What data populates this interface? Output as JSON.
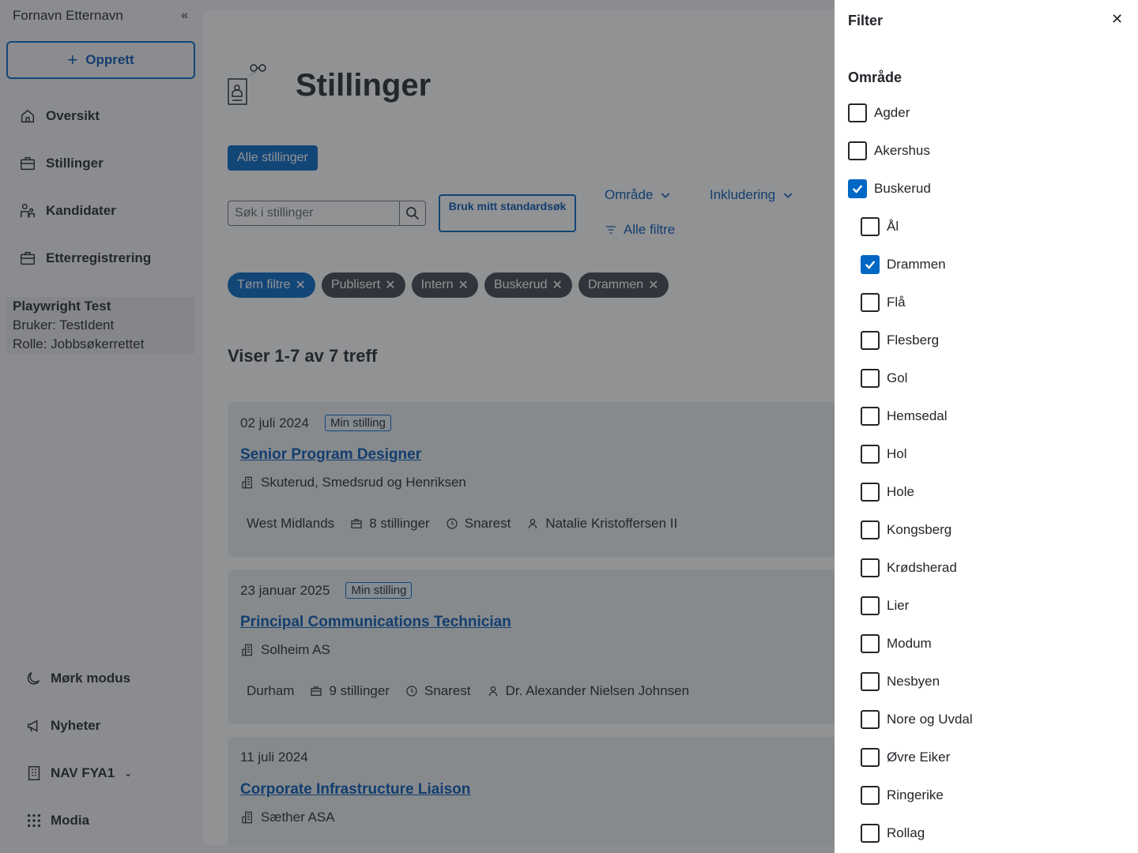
{
  "sidebar": {
    "user_name": "Fornavn Etternavn",
    "collapse_icon": "«",
    "create_label": "Opprett",
    "nav": [
      {
        "label": "Oversikt",
        "icon": "home-icon"
      },
      {
        "label": "Stillinger",
        "icon": "briefcase-icon"
      },
      {
        "label": "Kandidater",
        "icon": "people-icon"
      },
      {
        "label": "Etterregistrering",
        "icon": "briefcase-icon"
      }
    ],
    "test_user": {
      "name": "Playwright Test",
      "user": "Bruker: TestIdent",
      "role": "Rolle: Jobbsøkerrettet"
    },
    "bottom": [
      {
        "label": "Mørk modus",
        "icon": "moon-icon"
      },
      {
        "label": "Nyheter",
        "icon": "megaphone-icon"
      },
      {
        "label": "NAV FYA1",
        "icon": "building-icon"
      },
      {
        "label": "Modia",
        "icon": "grid-icon"
      }
    ]
  },
  "main": {
    "title": "Stillinger",
    "all_label": "Alle stillinger",
    "search_placeholder": "Søk i stillinger",
    "std_search": "Bruk mitt standardsøk",
    "dropdowns": [
      "Område",
      "Inkludering"
    ],
    "all_filters": "Alle filtre",
    "chips": [
      "Tøm filtre",
      "Publisert",
      "Intern",
      "Buskerud",
      "Drammen"
    ],
    "count": "Viser 1-7 av 7 treff",
    "cards": [
      {
        "date": "02 juli 2024",
        "tag": "Min stilling",
        "title": "Senior Program Designer",
        "employer": "Skuterud, Smedsrud og Henriksen",
        "location": "West Midlands",
        "positions": "8 stillinger",
        "deadline": "Snarest",
        "owner": "Natalie Kristoffersen II"
      },
      {
        "date": "23 januar 2025",
        "tag": "Min stilling",
        "title": "Principal Communications Technician",
        "employer": "Solheim AS",
        "location": "Durham",
        "positions": "9 stillinger",
        "deadline": "Snarest",
        "owner": "Dr. Alexander Nielsen Johnsen"
      },
      {
        "date": "11 juli 2024",
        "tag": "",
        "title": "Corporate Infrastructure Liaison",
        "employer": "Sæther ASA",
        "location": "",
        "positions": "",
        "deadline": "",
        "owner": ""
      }
    ]
  },
  "filter": {
    "title": "Filter",
    "section": "Område",
    "options": [
      {
        "label": "Agder",
        "checked": false,
        "indent": false
      },
      {
        "label": "Akershus",
        "checked": false,
        "indent": false
      },
      {
        "label": "Buskerud",
        "checked": true,
        "indent": false
      },
      {
        "label": "Ål",
        "checked": false,
        "indent": true
      },
      {
        "label": "Drammen",
        "checked": true,
        "indent": true
      },
      {
        "label": "Flå",
        "checked": false,
        "indent": true
      },
      {
        "label": "Flesberg",
        "checked": false,
        "indent": true
      },
      {
        "label": "Gol",
        "checked": false,
        "indent": true
      },
      {
        "label": "Hemsedal",
        "checked": false,
        "indent": true
      },
      {
        "label": "Hol",
        "checked": false,
        "indent": true
      },
      {
        "label": "Hole",
        "checked": false,
        "indent": true
      },
      {
        "label": "Kongsberg",
        "checked": false,
        "indent": true
      },
      {
        "label": "Krødsherad",
        "checked": false,
        "indent": true
      },
      {
        "label": "Lier",
        "checked": false,
        "indent": true
      },
      {
        "label": "Modum",
        "checked": false,
        "indent": true
      },
      {
        "label": "Nesbyen",
        "checked": false,
        "indent": true
      },
      {
        "label": "Nore og Uvdal",
        "checked": false,
        "indent": true
      },
      {
        "label": "Øvre Eiker",
        "checked": false,
        "indent": true
      },
      {
        "label": "Ringerike",
        "checked": false,
        "indent": true
      },
      {
        "label": "Rollag",
        "checked": false,
        "indent": true
      }
    ]
  },
  "colors": {
    "accent": "#0067c5",
    "chip_dark": "#3f444c"
  }
}
